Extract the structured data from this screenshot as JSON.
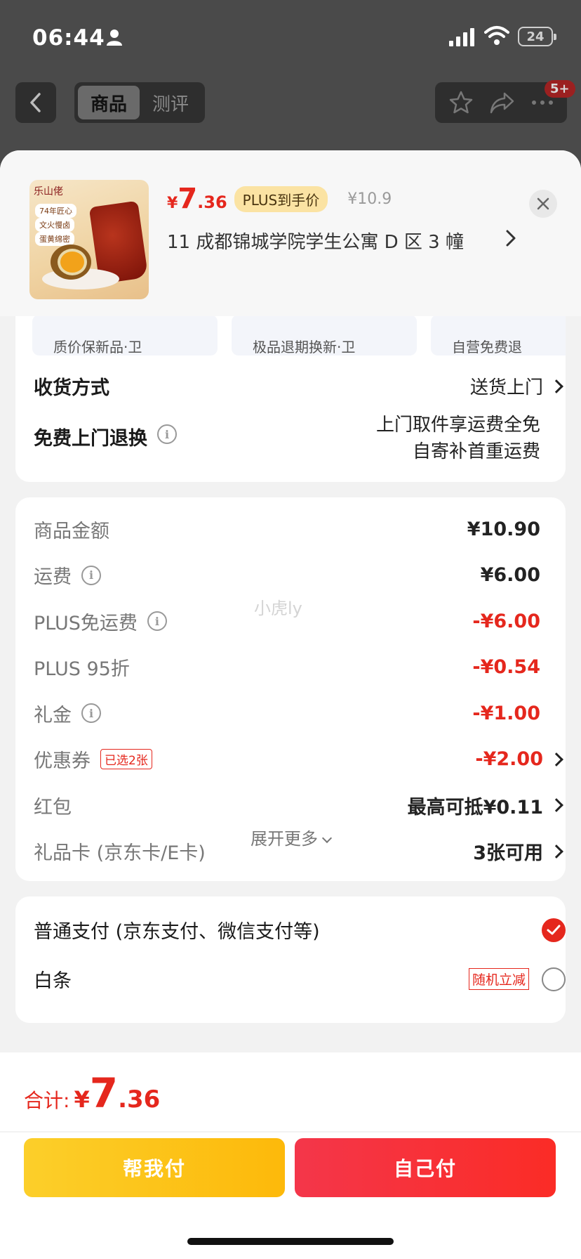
{
  "status_bar": {
    "time": "06:44",
    "battery": "24"
  },
  "nav": {
    "tabs": [
      "商品",
      "测评"
    ],
    "badge": "5+"
  },
  "product": {
    "price_symbol": "¥",
    "price_integer": "7",
    "price_decimal": ".36",
    "plus_tag": "PLUS到手价",
    "original_price": "¥10.9",
    "address": "11  成都锦城学院学生公寓 D 区 3 幢",
    "thumb": {
      "brand": "乐山佬",
      "tags": [
        "74年匠心",
        "文火慢卤",
        "蛋黄绵密"
      ]
    }
  },
  "service_chips": [
    "质价保新品·卫",
    "极品退期换新·卫",
    "自营免费退"
  ],
  "delivery": {
    "label": "收货方式",
    "value": "送货上门"
  },
  "free_return": {
    "label": "免费上门退换",
    "line1": "上门取件享运费全免",
    "line2": "自寄补首重运费"
  },
  "fees": [
    {
      "label": "商品金额",
      "value": "¥10.90",
      "red": false,
      "info": false,
      "tag": "",
      "arrow": false
    },
    {
      "label": "运费",
      "value": "¥6.00",
      "red": false,
      "info": true,
      "tag": "",
      "arrow": false
    },
    {
      "label": "PLUS免运费",
      "value": "-¥6.00",
      "red": true,
      "info": true,
      "tag": "",
      "arrow": false
    },
    {
      "label": "PLUS 95折",
      "value": "-¥0.54",
      "red": true,
      "info": false,
      "tag": "",
      "arrow": false
    },
    {
      "label": "礼金",
      "value": "-¥1.00",
      "red": true,
      "info": true,
      "tag": "",
      "arrow": false
    },
    {
      "label": "优惠券",
      "value": "-¥2.00",
      "red": true,
      "info": false,
      "tag": "已选2张",
      "arrow": true
    },
    {
      "label": "红包",
      "value": "最高可抵¥0.11",
      "red": false,
      "info": false,
      "tag": "",
      "arrow": true
    },
    {
      "label": "礼品卡 (京东卡/E卡)",
      "value": "3张可用",
      "red": false,
      "info": false,
      "tag": "",
      "arrow": true
    }
  ],
  "expand_more": "展开更多",
  "payment": {
    "option1": "普通支付 (京东支付、微信支付等)",
    "option2": "白条",
    "option2_tag": "随机立减"
  },
  "watermark": "小虎ly",
  "footer": {
    "total_label": "合计:",
    "total_symbol": "¥",
    "total_integer": "7",
    "total_decimal": ".36",
    "help_pay": "帮我付",
    "self_pay": "自己付"
  },
  "colors": {
    "accent_red": "#e5271d",
    "help_yellow": "#fdc21a",
    "pay_red": "#f5303f"
  }
}
